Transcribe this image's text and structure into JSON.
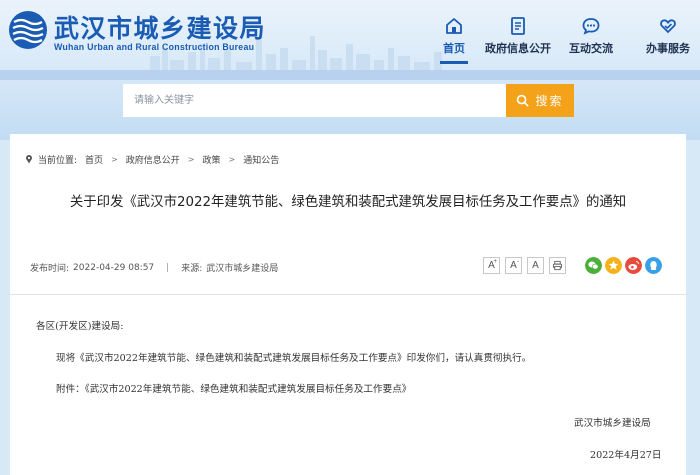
{
  "brand": {
    "name_cn": "武汉市城乡建设局",
    "name_en": "Wuhan Urban and Rural Construction Bureau",
    "color": "#1a5cb4"
  },
  "nav": [
    {
      "label": "首页",
      "icon": "home-icon",
      "active": true
    },
    {
      "label": "政府信息公开",
      "icon": "document-icon"
    },
    {
      "label": "互动交流",
      "icon": "chat-icon"
    },
    {
      "label": "办事服务",
      "icon": "heart-hand-icon"
    }
  ],
  "search": {
    "placeholder": "请输入关键字",
    "button_label": "搜索",
    "accent": "#f3a21a"
  },
  "breadcrumb": {
    "prefix": "当前位置:",
    "items": [
      "首页",
      "政府信息公开",
      "政策",
      "通知公告"
    ]
  },
  "article": {
    "title": "关于印发《武汉市2022年建筑节能、绿色建筑和装配式建筑发展目标任务及工作要点》的通知",
    "published_label": "发布时间:",
    "published": "2022-04-29 08:57",
    "source_label": "来源:",
    "source": "武汉市城乡建设局",
    "greeting": "各区(开发区)建设局:",
    "paragraph": "现将《武汉市2022年建筑节能、绿色建筑和装配式建筑发展目标任务及工作要点》印发你们，请认真贯彻执行。",
    "attachment": "附件：《武汉市2022年建筑节能、绿色建筑和装配式建筑发展目标任务及工作要点》",
    "signature": "武汉市城乡建设局",
    "date": "2022年4月27日"
  },
  "tools": [
    {
      "label": "A",
      "icon": "font-larger-icon",
      "sup": "+"
    },
    {
      "label": "A",
      "icon": "font-smaller-icon",
      "sup": "-"
    },
    {
      "label": "A",
      "icon": "font-default-icon"
    },
    {
      "label": "",
      "icon": "print-icon"
    }
  ],
  "share": [
    {
      "icon": "wechat-icon",
      "color": "#4caf3a"
    },
    {
      "icon": "qzone-icon",
      "color": "#f7b21a"
    },
    {
      "icon": "weibo-icon",
      "color": "#e64b3c"
    },
    {
      "icon": "qq-icon",
      "color": "#3aa0e6"
    }
  ]
}
